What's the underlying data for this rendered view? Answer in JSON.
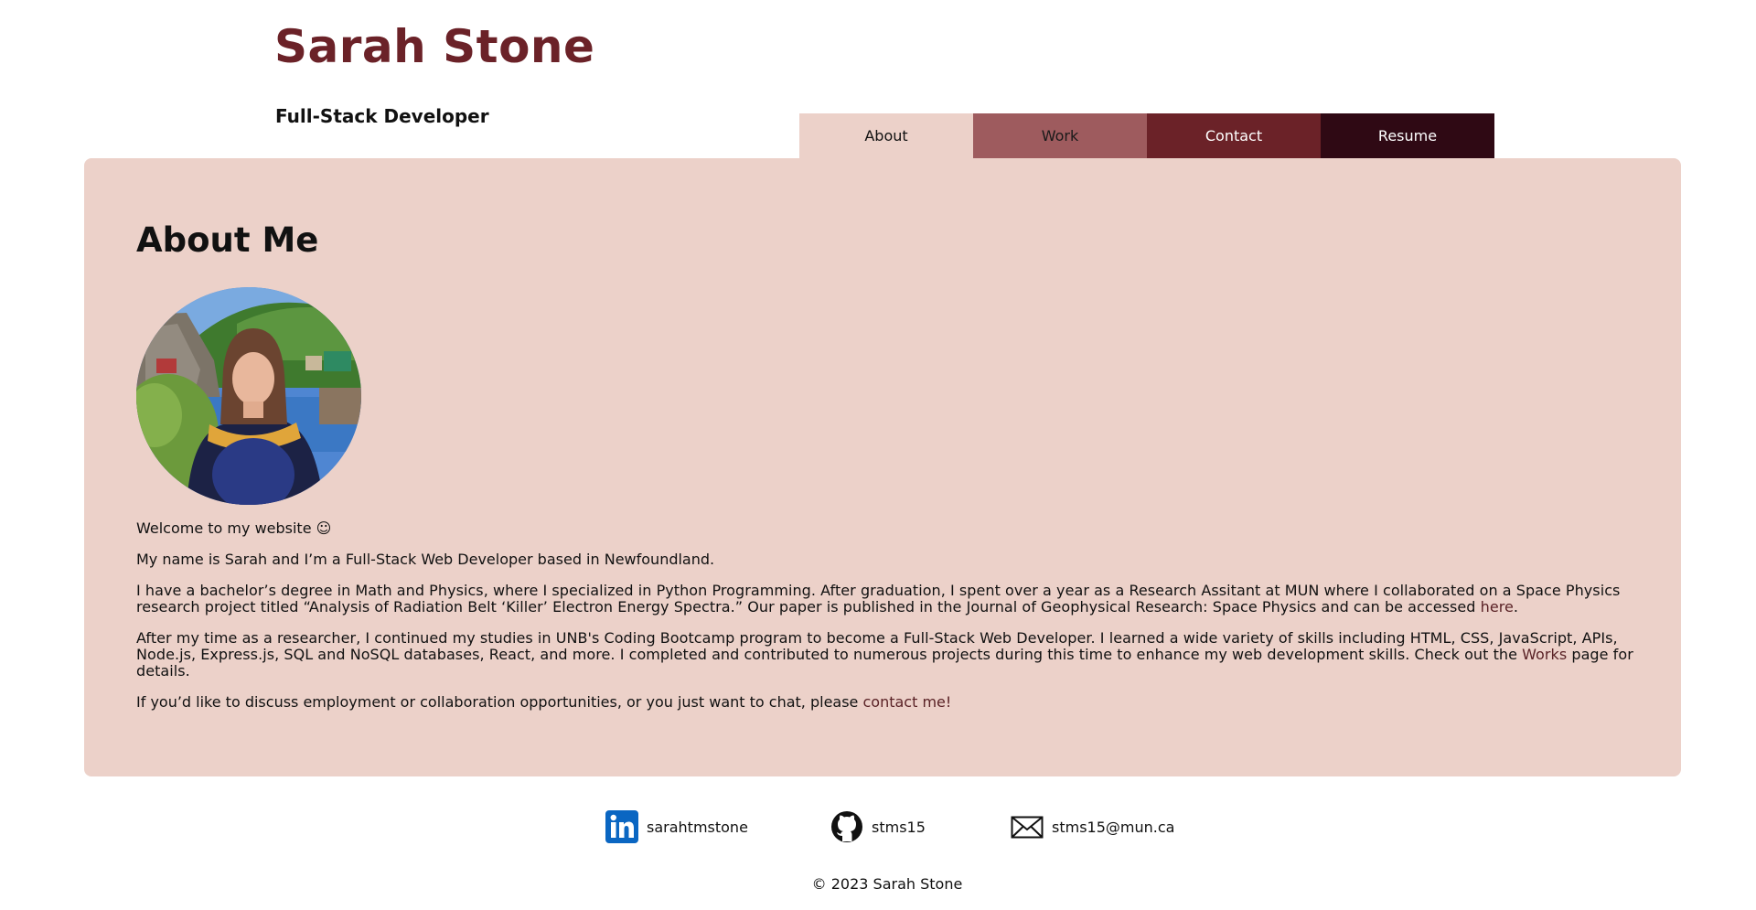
{
  "header": {
    "title": "Sarah Stone",
    "subtitle": "Full-Stack Developer"
  },
  "nav": {
    "tabs": [
      {
        "label": "About",
        "active": true,
        "color": "#ecd1c9"
      },
      {
        "label": "Work",
        "color": "#9e5b5e"
      },
      {
        "label": "Contact",
        "color": "#6b2228"
      },
      {
        "label": "Resume",
        "color": "#2f0914"
      }
    ]
  },
  "about": {
    "heading": "About Me",
    "photo_icon": "portrait-photo",
    "welcome": "Welcome to my website ☺",
    "intro": "My name is Sarah and I’m a Full-Stack Web Developer based in Newfoundland.",
    "education_text": "I have a bachelor’s degree in Math and Physics, where I specialized in Python Programming. After graduation, I spent over a year as a Research Assitant at MUN where I collaborated on a Space Physics research project titled “Analysis of Radiation Belt ‘Killer’ Electron Energy Spectra.” Our paper is published in the Journal of Geophysical Research: Space Physics and can be accessed ",
    "education_link": "here",
    "education_end": ".",
    "bootcamp_text": "After my time as a researcher, I continued my studies in UNB's Coding Bootcamp program to become a Full-Stack Web Developer. I learned a wide variety of skills including HTML, CSS, JavaScript, APIs, Node.js, Express.js, SQL and NoSQL databases, React, and more. I completed and contributed to numerous projects during this time to enhance my web development skills. Check out the ",
    "bootcamp_link": "Works",
    "bootcamp_end": " page for details.",
    "contact_text": "If you’d like to discuss employment or collaboration opportunities, or you just want to chat, please ",
    "contact_link": "contact me!"
  },
  "footer": {
    "links": [
      {
        "icon": "linkedin-icon",
        "label": "sarahtmstone"
      },
      {
        "icon": "github-icon",
        "label": "stms15"
      },
      {
        "icon": "mail-icon",
        "label": "stms15@mun.ca"
      }
    ],
    "copyright": "© 2023 Sarah Stone"
  },
  "colors": {
    "brand": "#6b2228",
    "panel": "#ecd1c9",
    "linkedin": "#0a66c2"
  }
}
